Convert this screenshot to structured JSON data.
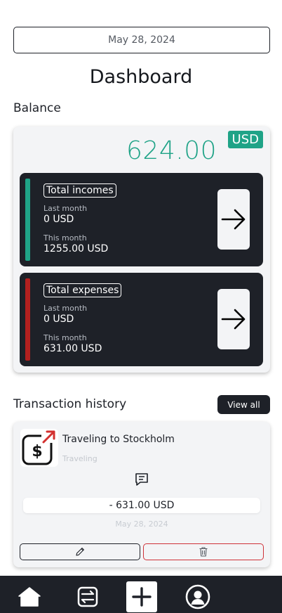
{
  "header": {
    "date": "May 28, 2024",
    "title": "Dashboard"
  },
  "balance": {
    "section_label": "Balance",
    "amount": "624.00",
    "currency": "USD",
    "incomes": {
      "heading": "Total incomes",
      "last_month_label": "Last month",
      "last_month_value": "0 USD",
      "this_month_label": "This month",
      "this_month_value": "1255.00 USD",
      "accent_color": "#1fa387"
    },
    "expenses": {
      "heading": "Total expenses",
      "last_month_label": "Last month",
      "last_month_value": "0 USD",
      "this_month_label": "This month",
      "this_month_value": "631.00 USD",
      "accent_color": "#b3201f"
    }
  },
  "transactions": {
    "section_label": "Transaction history",
    "view_all_label": "View all",
    "items": [
      {
        "title": "Traveling to Stockholm",
        "category": "Traveling",
        "amount": "- 631.00 USD",
        "date": "May 28, 2024",
        "icon": "dollar-expense-icon",
        "comment_icon": "comment-icon"
      }
    ]
  },
  "nav": {
    "items": [
      "home-icon",
      "transactions-icon",
      "add-icon",
      "profile-icon"
    ]
  },
  "colors": {
    "accent": "#1fa387",
    "dark": "#1e2128",
    "danger": "#cf3238",
    "card": "#f3f4f6"
  }
}
